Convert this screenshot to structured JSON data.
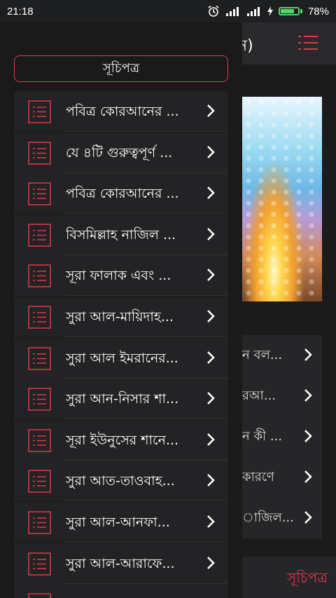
{
  "status_bar": {
    "time": "21:18",
    "battery_percent": "78%",
    "battery_level": 0.78
  },
  "background": {
    "title_fragment": "ন)",
    "items": [
      "ন বল...",
      "রআ...",
      "ন কী ...",
      "কারণে",
      "াজিল..."
    ],
    "bottom_label": "সূচিপত্র"
  },
  "drawer": {
    "header": "সূচিপত্র",
    "items": [
      {
        "label": "পবিত্র কোরআনের ..."
      },
      {
        "label": "যে ৪টি গুরুত্বপূর্ণ ..."
      },
      {
        "label": "পবিত্র কোরআনের ..."
      },
      {
        "label": "বিসমিল্লাহ নাজিল ..."
      },
      {
        "label": "সূরা ফালাক এবং ..."
      },
      {
        "label": "সুরা আল-মায়িদাহ..."
      },
      {
        "label": "সুরা আল ইমরানের..."
      },
      {
        "label": "সুরা আন-নিসার শা..."
      },
      {
        "label": "সূরা ইউনুসের শানে..."
      },
      {
        "label": "সুরা আত-তাওবাহ..."
      },
      {
        "label": "সুরা আল-আনফা..."
      },
      {
        "label": "সুরা আল-আরাফে..."
      }
    ]
  },
  "colors": {
    "accent": "#e0394a",
    "drawer_bg": "#1a1a1a",
    "item_bg": "#232325"
  }
}
